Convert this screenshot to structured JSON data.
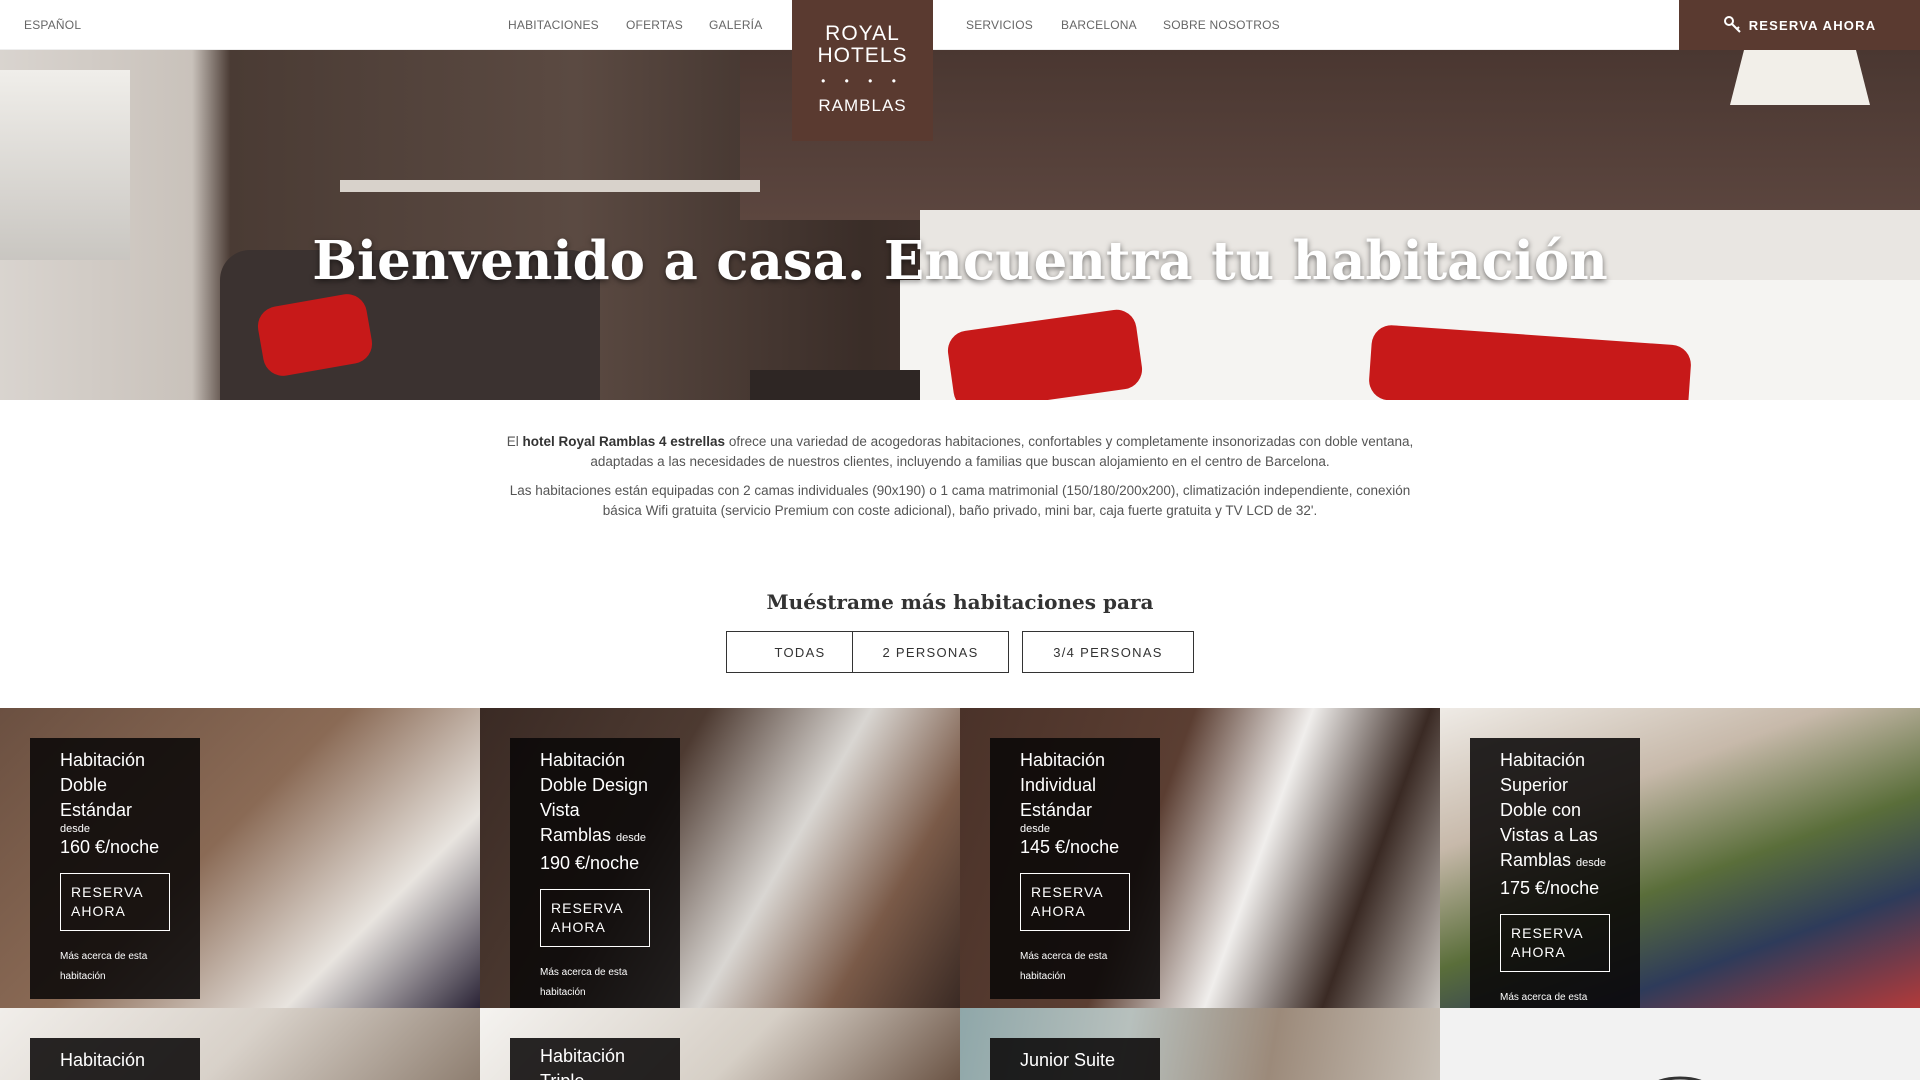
{
  "header": {
    "language": "ESPAÑOL",
    "nav_left": [
      "HABITACIONES",
      "OFERTAS",
      "GALERÍA"
    ],
    "nav_right": [
      "SERVICIOS",
      "BARCELONA",
      "SOBRE NOSOTROS"
    ],
    "logo": {
      "line1": "ROYAL",
      "line2": "HOTELS",
      "dots": "• • • •",
      "line3": "RAMBLAS"
    },
    "reserve_label": "RESERVA AHORA"
  },
  "hero": {
    "title": "Bienvenido a casa. Encuentra tu habitación"
  },
  "intro": {
    "p1_prefix": "El ",
    "p1_bold": "hotel Royal Ramblas 4 estrellas",
    "p1_rest": " ofrece una variedad de acogedoras habitaciones, confortables y completamente insonorizadas con doble ventana, adaptadas a las necesidades de nuestros clientes, incluyendo a familias que buscan alojamiento en el centro de Barcelona.",
    "p2": "Las habitaciones están equipadas con 2 camas individuales (90x190) o 1 cama matrimonial (150/180/200x200), climatización independiente, conexión básica Wifi gratuita (servicio Premium con coste adicional), baño privado, mini bar, caja fuerte gratuita y TV LCD de 32'."
  },
  "filter": {
    "title": "Muéstrame más habitaciones para",
    "buttons": [
      "TODAS",
      "2 PERSONAS",
      "3/4 PERSONAS"
    ]
  },
  "rooms": [
    {
      "name": "Habitación Doble Estándar",
      "desde": "desde",
      "price": "160 €/noche",
      "reserve": "RESERVA AHORA",
      "more": "Más acerca de esta habitación"
    },
    {
      "name": "Habitación Doble Design Vista Ramblas",
      "desde": "desde",
      "price": "190 €/noche",
      "reserve": "RESERVA AHORA",
      "more": "Más acerca de esta habitación"
    },
    {
      "name": "Habitación Individual Estándar",
      "desde": "desde",
      "price": "145 €/noche",
      "reserve": "RESERVA AHORA",
      "more": "Más acerca de esta habitación"
    },
    {
      "name": "Habitación Superior Doble con Vistas a Las Ramblas",
      "desde": "desde",
      "price": "175 €/noche",
      "reserve": "RESERVA AHORA",
      "more": "Más acerca de esta"
    }
  ],
  "rooms_row2": [
    {
      "name": "Habitación"
    },
    {
      "name": "Habitación Triple"
    },
    {
      "name": "Junior Suite"
    }
  ],
  "colors": {
    "brand": "#5a3a30",
    "panel": "#0a0808",
    "text": "#333333"
  }
}
